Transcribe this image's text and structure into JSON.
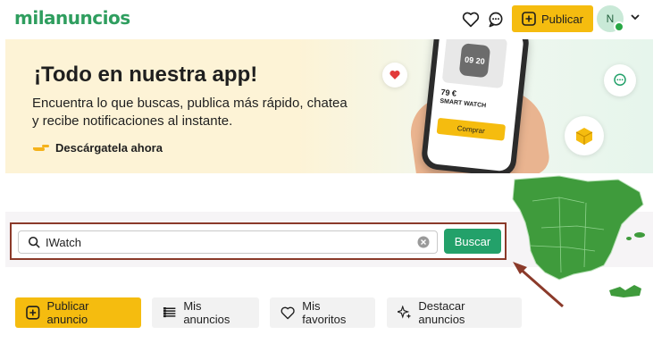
{
  "header": {
    "logo": "milanuncios",
    "publish_label": "Publicar",
    "avatar_initial": "N"
  },
  "banner": {
    "title": "¡Todo en nuestra app!",
    "text": "Encuentra lo que buscas, publica más rápido, chatea y recibe notificaciones al instante.",
    "download_label": "Descárgatela ahora",
    "phone": {
      "price": "79 €",
      "product": "SMART WATCH",
      "watch_time": "09 20",
      "buy_label": "Comprar"
    }
  },
  "search": {
    "value": "IWatch",
    "button_label": "Buscar"
  },
  "actions": [
    {
      "label": "Publicar anuncio"
    },
    {
      "label": "Mis anuncios"
    },
    {
      "label": "Mis favoritos"
    },
    {
      "label": "Destacar anuncios"
    }
  ],
  "colors": {
    "brand_green": "#2f9e5f",
    "accent_yellow": "#f5bc0f",
    "search_button": "#23a16a",
    "annotation_red": "#8b3a2a"
  }
}
